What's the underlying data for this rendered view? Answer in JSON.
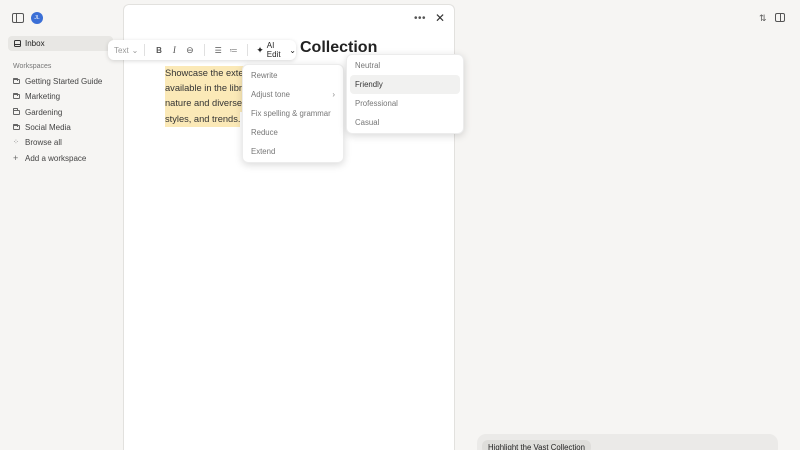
{
  "sidebar": {
    "avatar_initials": "JL",
    "inbox_label": "Inbox",
    "workspaces_heading": "Workspaces",
    "workspaces": [
      "Getting Started Guide",
      "Marketing",
      "Gardening",
      "Social Media"
    ],
    "browse_all_label": "Browse all",
    "add_workspace_label": "Add a workspace"
  },
  "document": {
    "title_visible": "Collection",
    "body_lines": [
      "Showcase the exte",
      "available in the libra",
      "nature and diverse",
      "styles, and trends."
    ]
  },
  "toolbar": {
    "text_style": "Text",
    "bold": "B",
    "italic": "I",
    "ai_edit_label": "AI Edit"
  },
  "ai_menu": {
    "items": [
      "Rewrite",
      "Adjust tone",
      "Fix spelling & grammar",
      "Reduce",
      "Extend"
    ]
  },
  "tone_menu": {
    "items": [
      "Neutral",
      "Friendly",
      "Professional",
      "Casual"
    ],
    "hovered": "Friendly"
  },
  "chat": {
    "chip_label": "Highlight the Vast Collection"
  },
  "colors": {
    "highlight": "#fbe9b7",
    "avatar": "#3b6fd6",
    "background": "#f6f5f3"
  }
}
